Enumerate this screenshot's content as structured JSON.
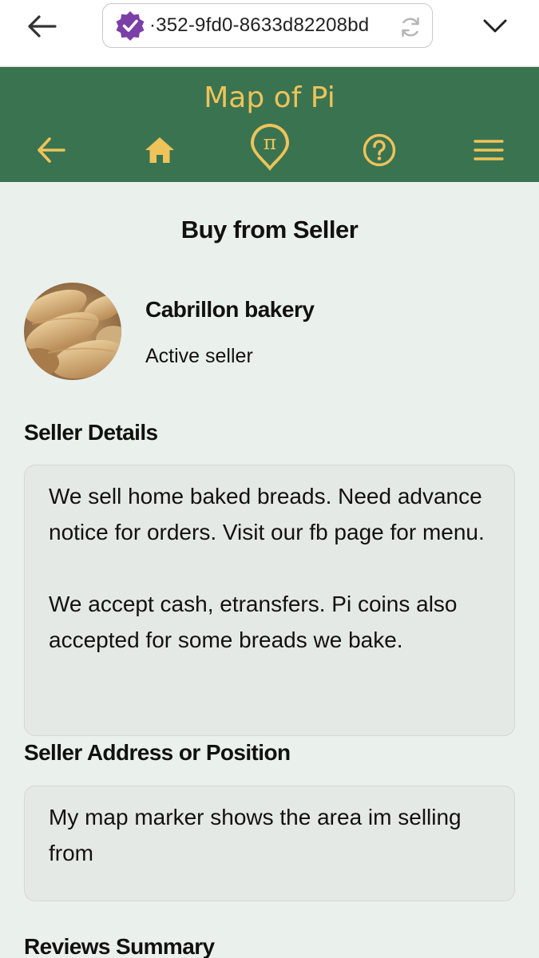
{
  "browser": {
    "url_text": "·352-9fd0-8633d82208bd",
    "badge_icon": "verified-badge-icon",
    "back_icon": "arrow-left-icon",
    "reload_icon": "reload-icon",
    "menu_icon": "chevron-down-icon"
  },
  "header": {
    "title": "Map of Pi",
    "pi_glyph": "π",
    "icons": [
      "back-arrow-icon",
      "home-icon",
      "pi-location-icon",
      "help-icon",
      "hamburger-menu-icon"
    ],
    "bg_color": "#3a7350",
    "accent_color": "#eec35a"
  },
  "page": {
    "title": "Buy from Seller"
  },
  "seller": {
    "name": "Cabrillon bakery",
    "status": "Active seller"
  },
  "sections": {
    "details_heading": "Seller Details",
    "details_text": "We sell home baked breads. Need advance notice for orders.  Visit our fb page for menu.\n\nWe accept cash, etransfers. Pi coins also accepted for some breads we bake.",
    "address_heading": "Seller Address or Position",
    "address_text": "My map marker shows the area im selling from",
    "reviews_heading": "Reviews Summary"
  }
}
